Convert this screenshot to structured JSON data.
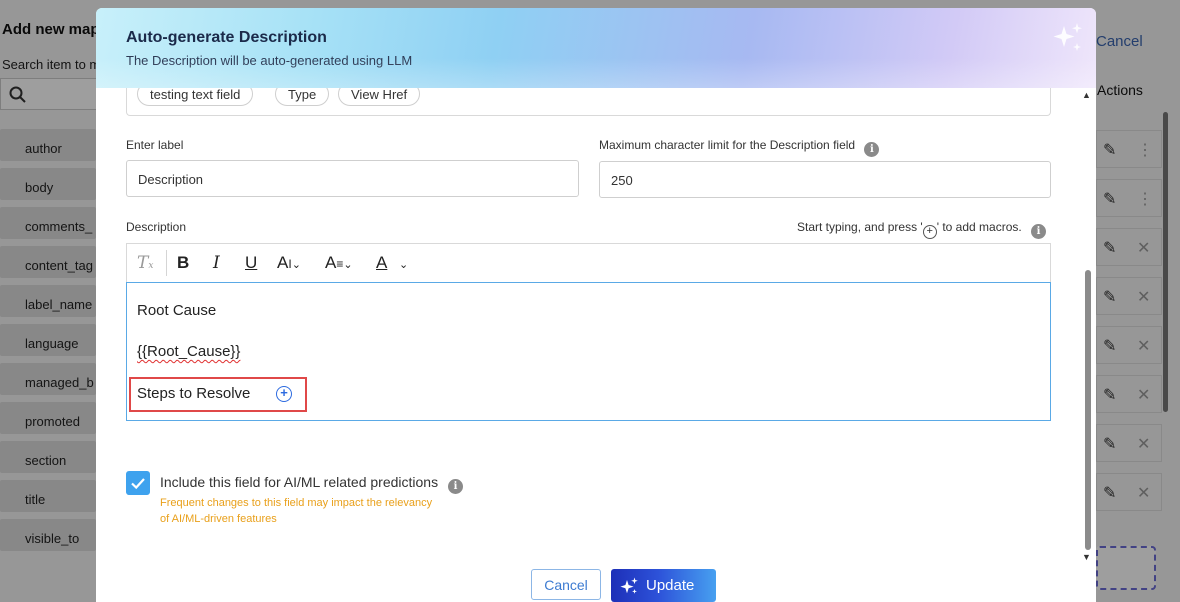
{
  "background": {
    "title": "Add new map",
    "search_label": "Search item to m",
    "items": [
      "author",
      "body",
      "comments_",
      "content_tag",
      "label_name",
      "language",
      "managed_b",
      "promoted",
      "section",
      "title",
      "visible_to"
    ],
    "cancel": "Cancel",
    "actions_header": "Actions"
  },
  "modal": {
    "title": "Auto-generate Description",
    "subtitle": "The Description will be auto-generated using LLM",
    "tags": [
      "testing text field",
      "Type",
      "View Href"
    ],
    "label_field": {
      "label": "Enter label",
      "value": "Description"
    },
    "limit_field": {
      "label": "Maximum character limit for the Description field",
      "value": "250"
    },
    "description": {
      "label": "Description",
      "hint_before": "Start typing, and press '",
      "hint_after": "' to add macros.",
      "lines": [
        "Root Cause",
        "{{Root_Cause}}",
        "Steps to Resolve"
      ]
    },
    "ai_checkbox": {
      "checked": true,
      "label": "Include this field for AI/ML related predictions",
      "warning_line1": "Frequent changes to this field may impact the relevancy",
      "warning_line2": "of AI/ML-driven features"
    },
    "cancel_label": "Cancel",
    "update_label": "Update"
  },
  "colors": {
    "accent": "#3ea2ee",
    "warning": "#e9a01b",
    "highlight": "#e04848",
    "update_gradient_start": "#1d2fb8",
    "update_gradient_end": "#47a0f0"
  }
}
